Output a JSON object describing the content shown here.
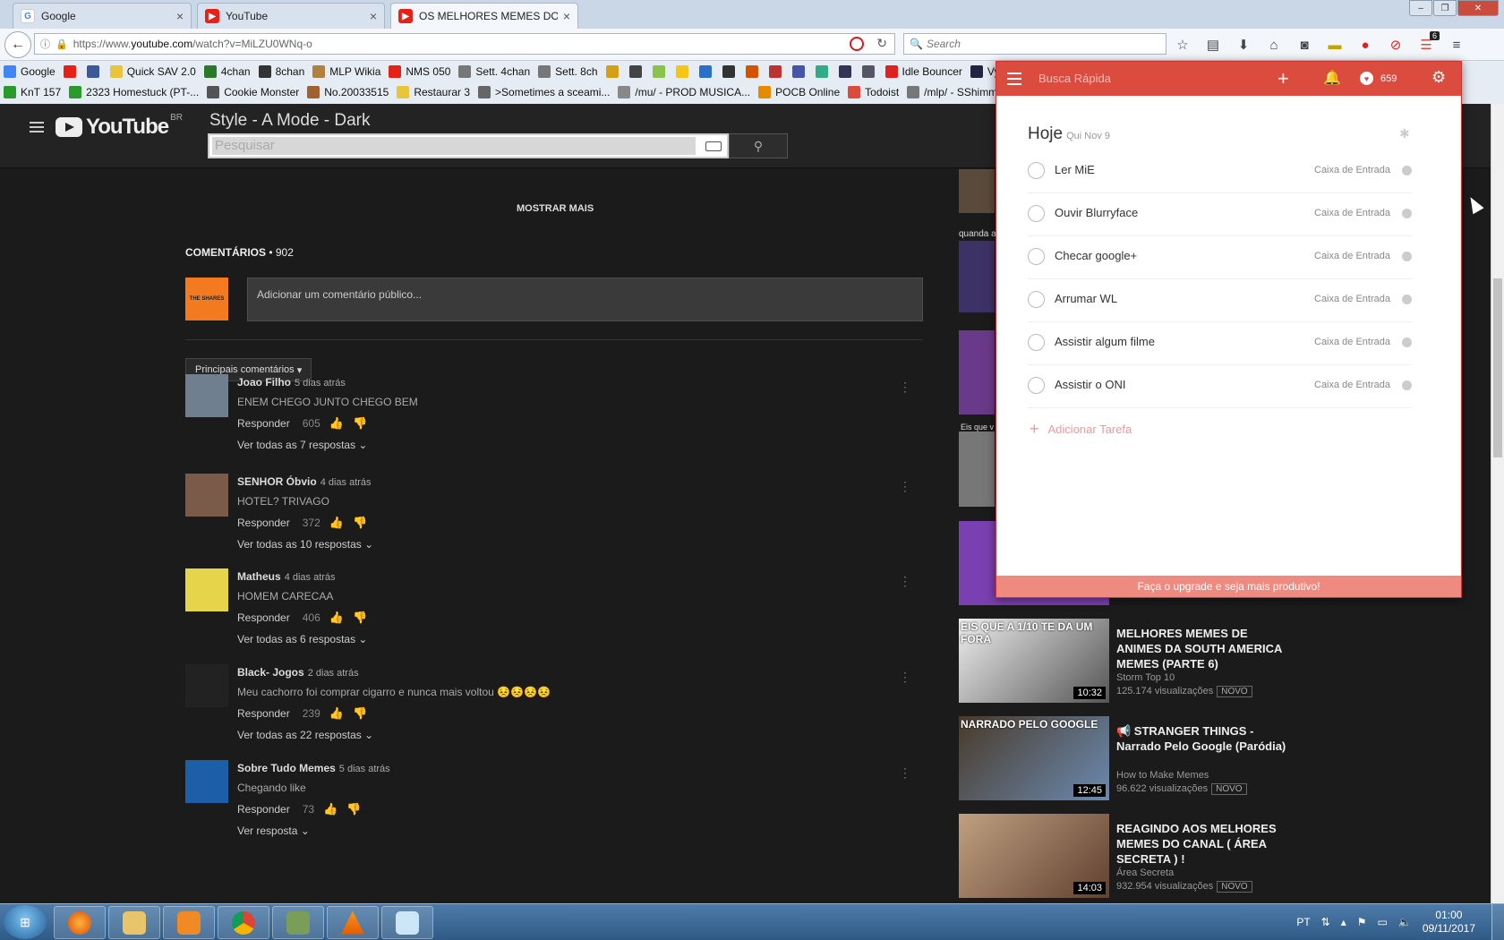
{
  "browser": {
    "tabs": [
      {
        "label": "Google",
        "active": false
      },
      {
        "label": "YouTube",
        "active": false
      },
      {
        "label": "OS MELHORES MEMES DO...",
        "active": true
      }
    ],
    "url_prefix": "https://www.",
    "url_host": "youtube.com",
    "url_path": "/watch?v=MiLZU0WNq-o",
    "search_placeholder": "Search",
    "extension_badge": "6",
    "bookmarks_row1": [
      "Google",
      "",
      "",
      "Quick SAV 2.0",
      "4chan",
      "8chan",
      "MLP Wikia",
      "NMS 050",
      "Sett. 4chan",
      "Sett. 8ch",
      "",
      "",
      "",
      "",
      "",
      "",
      "",
      "",
      "",
      "",
      "",
      "",
      "Idle Bouncer",
      "Vybz | Sav"
    ],
    "bookmarks_row2": [
      "KnT 157",
      "2323 Homestuck (PT-...",
      "Cookie Monster",
      "No.20033515",
      "Restaurar 3",
      ">Sometimes a sceami...",
      "/mu/ - PROD MUSICA...",
      "POCB Online",
      "Todoist",
      "/mlp/ - SShimm"
    ]
  },
  "youtube": {
    "logo_text": "YouTube",
    "logo_region": "BR",
    "style_title": "Style - A  Mode - Dark",
    "search_placeholder": "Pesquisar",
    "show_more": "MOSTRAR MAIS",
    "comments_label": "COMENTÁRIOS",
    "comments_count": " • 902",
    "self_avatar_text": "THE SHARES",
    "add_comment_placeholder": "Adicionar um comentário público...",
    "sort_label": "Principais comentários",
    "comments": [
      {
        "author": "Joao Filho",
        "time": "5 dias atrás",
        "text": "ENEM CHEGO JUNTO CHEGO BEM",
        "reply": "Responder",
        "likes": "605",
        "replies": "Ver todas as 7 respostas",
        "color": "#6f7f8f"
      },
      {
        "author": "SENHOR Óbvio",
        "time": "4 dias atrás",
        "text": "HOTEL? TRIVAGO",
        "reply": "Responder",
        "likes": "372",
        "replies": "Ver todas as 10 respostas",
        "color": "#7a5b4a"
      },
      {
        "author": "Matheus",
        "time": "4 dias atrás",
        "text": "HOMEM CARECAA",
        "reply": "Responder",
        "likes": "406",
        "replies": "Ver todas as 6 respostas",
        "color": "#e6d44a"
      },
      {
        "author": "Black- Jogos",
        "time": "2 dias atrás",
        "text": "Meu cachorro foi comprar cigarro e nunca mais voltou 😣😣😣😣",
        "reply": "Responder",
        "likes": "239",
        "replies": "Ver todas as 22 respostas",
        "color": "#222"
      },
      {
        "author": "Sobre Tudo Memes",
        "time": "5 dias atrás",
        "text": "Chegando like",
        "reply": "Responder",
        "likes": "73",
        "replies": "Ver resposta",
        "color": "#1d5ea8"
      }
    ],
    "sidebar_partial_text": "quanda a",
    "sidebar_partial_text2": "Eis que v",
    "sidebar_videos": [
      {
        "title": "MELHORES MEMES DE ANIMES DA SOUTH AMERICA MEMES (PARTE 6)",
        "channel": "Storm Top 10",
        "views": "125.174 visualizações",
        "badge": "NOVO",
        "duration": "10:32",
        "thumb_text": "EIS QUE A 1/10 TE DA UM FORA"
      },
      {
        "title": "📢 STRANGER THINGS - Narrado Pelo Google (Paródia)",
        "channel": "How to Make Memes",
        "views": "96.622 visualizações",
        "badge": "NOVO",
        "duration": "12:45",
        "thumb_text": "NARRADO PELO GOOGLE"
      },
      {
        "title": "REAGINDO AOS MELHORES MEMES DO CANAL ( ÁREA SECRETA ) !",
        "channel": "Área Secreta",
        "views": "932.954 visualizações",
        "badge": "NOVO",
        "duration": "14:03",
        "thumb_text": ""
      }
    ]
  },
  "todoist": {
    "quick_search": "Busca Rápida",
    "karma": "659",
    "today": "Hoje",
    "date": "Qui Nov 9",
    "tasks": [
      {
        "name": "Ler MiE",
        "project": "Caixa de Entrada"
      },
      {
        "name": "Ouvir Blurryface",
        "project": "Caixa de Entrada"
      },
      {
        "name": "Checar google+",
        "project": "Caixa de Entrada"
      },
      {
        "name": "Arrumar WL",
        "project": "Caixa de Entrada"
      },
      {
        "name": "Assistir algum filme",
        "project": "Caixa de Entrada"
      },
      {
        "name": "Assistir o ONI",
        "project": "Caixa de Entrada"
      }
    ],
    "add_task": "Adicionar Tarefa",
    "upgrade": "Faça o upgrade e seja mais produtivo!",
    "accent": "#db4c3f"
  },
  "taskbar": {
    "lang": "PT",
    "time": "01:00",
    "date": "09/11/2017"
  }
}
